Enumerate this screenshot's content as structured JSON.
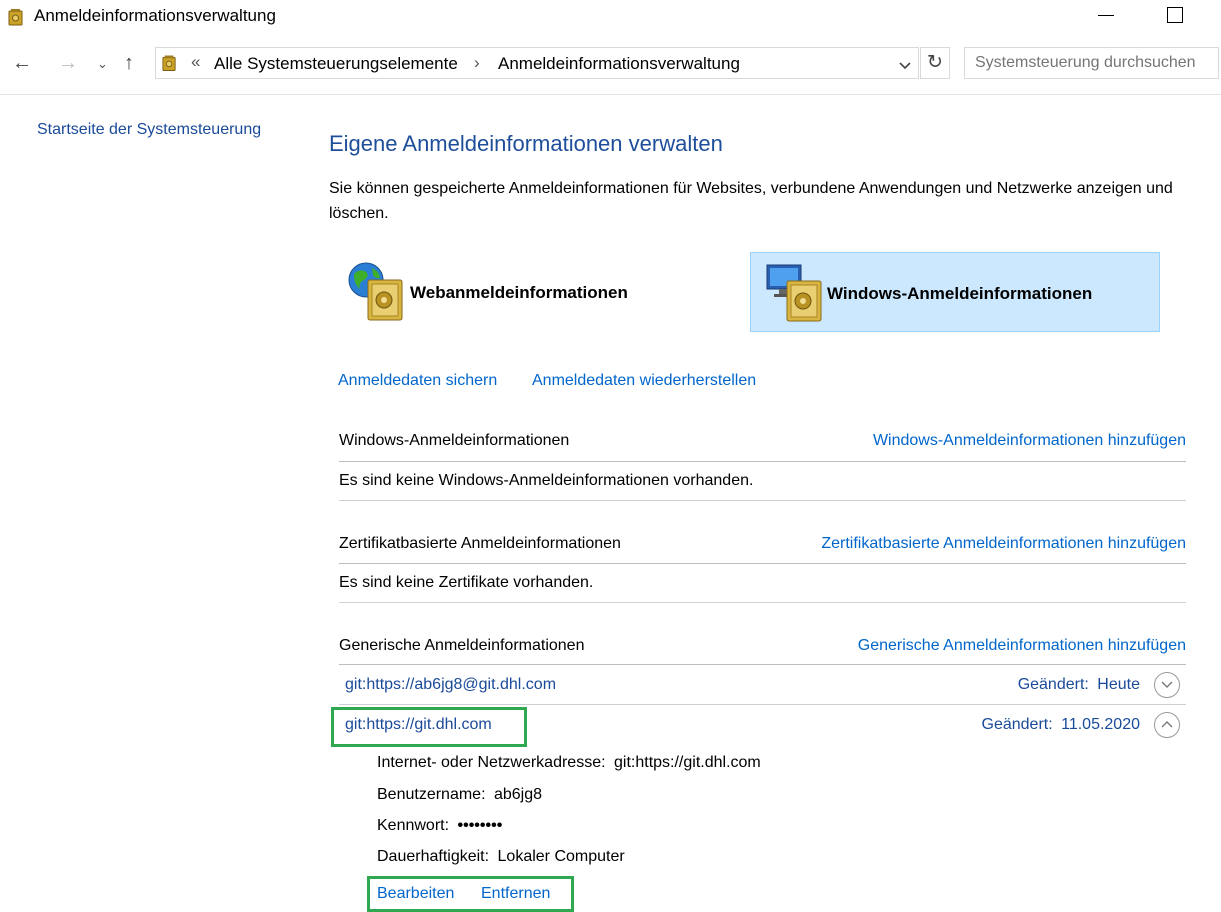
{
  "window": {
    "title": "Anmeldeinformationsverwaltung"
  },
  "nav": {
    "back": "←",
    "forward": "→",
    "recent": "⌄",
    "up": "↑",
    "address": {
      "chevron": "«",
      "segments": [
        "Alle Systemsteuerungselemente",
        "Anmeldeinformationsverwaltung"
      ],
      "separator": "›"
    },
    "refresh": "↻",
    "search_placeholder": "Systemsteuerung durchsuchen"
  },
  "sidebar": {
    "home_link": "Startseite der Systemsteuerung"
  },
  "main": {
    "title": "Eigene Anmeldeinformationen verwalten",
    "description": "Sie können gespeicherte Anmeldeinformationen für Websites, verbundene Anwendungen und Netzwerke anzeigen und löschen.",
    "tiles": {
      "web": "Webanmeldeinformationen",
      "windows": "Windows-Anmeldeinformationen"
    },
    "actions": {
      "backup": "Anmeldedaten sichern",
      "restore": "Anmeldedaten wiederherstellen"
    },
    "sections": {
      "windows": {
        "heading": "Windows-Anmeldeinformationen",
        "add_link": "Windows-Anmeldeinformationen hinzufügen",
        "empty": "Es sind keine Windows-Anmeldeinformationen vorhanden."
      },
      "certificate": {
        "heading": "Zertifikatbasierte Anmeldeinformationen",
        "add_link": "Zertifikatbasierte Anmeldeinformationen hinzufügen",
        "empty": "Es sind keine Zertifikate vorhanden."
      },
      "generic": {
        "heading": "Generische Anmeldeinformationen",
        "add_link": "Generische Anmeldeinformationen hinzufügen",
        "credentials": [
          {
            "name": "git:https://ab6jg8@git.dhl.com",
            "modified_label": "Geändert:",
            "modified_value": "Heute",
            "expanded": false
          },
          {
            "name": "git:https://git.dhl.com",
            "modified_label": "Geändert:",
            "modified_value": "11.05.2020",
            "expanded": true,
            "details": {
              "address_label": "Internet- oder Netzwerkadresse:",
              "address_value": "git:https://git.dhl.com",
              "user_label": "Benutzername:",
              "user_value": "ab6jg8",
              "password_label": "Kennwort:",
              "password_value": "••••••••",
              "persistence_label": "Dauerhaftigkeit:",
              "persistence_value": "Lokaler Computer"
            },
            "edit_link": "Bearbeiten",
            "remove_link": "Entfernen"
          }
        ]
      }
    }
  },
  "colors": {
    "link": "#0066cc",
    "title": "#1e4e9a",
    "selected_tile_bg": "#cce8ff",
    "highlight_box": "#2fa84f"
  }
}
